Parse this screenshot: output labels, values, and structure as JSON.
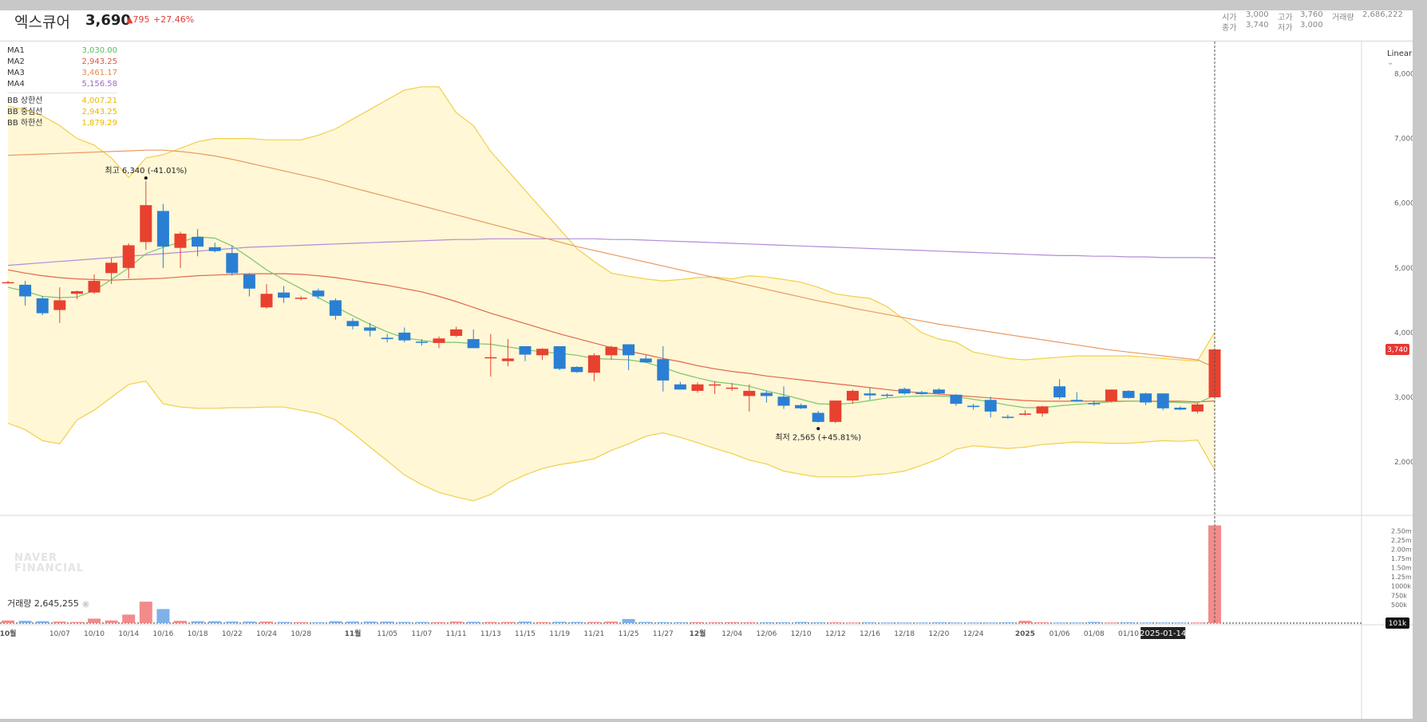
{
  "header": {
    "name": "엑스큐어",
    "price": "3,690",
    "diff": "▲795",
    "rate": "+27.46%",
    "open_label": "시가",
    "open_value": "3,000",
    "high_label": "고가",
    "high_value": "3,760",
    "volume_label": "거래량",
    "volume_value": "2,686,222",
    "close_label": "종가",
    "close_value": "3,740",
    "low_label": "저가",
    "low_value": "3,000"
  },
  "legend": {
    "ma": [
      {
        "name": "MA1",
        "value": "3,030.00",
        "color": "#5cb85c"
      },
      {
        "name": "MA2",
        "value": "2,943.25",
        "color": "#e2543a"
      },
      {
        "name": "MA3",
        "value": "3,461.17",
        "color": "#e68a4f"
      },
      {
        "name": "MA4",
        "value": "5,156.58",
        "color": "#9b6bcc"
      }
    ],
    "bb": [
      {
        "name": "BB 상한선",
        "value": "4,007.21",
        "color": "#e6b800"
      },
      {
        "name": "BB 중심선",
        "value": "2,943.25",
        "color": "#e6b800"
      },
      {
        "name": "BB 하한선",
        "value": "1,879.29",
        "color": "#e6b800"
      }
    ]
  },
  "scale_mode": "Linear",
  "watermark": [
    "NAVER",
    "FINANCIAL"
  ],
  "volume_title": "거래량 2,645,255",
  "colors": {
    "up": "#e8412f",
    "down": "#2a7fd4",
    "up_vol": "#f28b8b",
    "down_vol": "#7fb1e8",
    "band_fill": "#fff7d6"
  },
  "chart_data": {
    "type": "candlestick",
    "price_axis": {
      "ticks": [
        2000,
        3000,
        4000,
        5000,
        6000,
        7000,
        8000
      ],
      "tick_labels": [
        "2,000",
        "3,000",
        "4,000",
        "5,000",
        "6,000",
        "7,000",
        "8,000"
      ],
      "range": [
        1200,
        8500
      ]
    },
    "volume_axis": {
      "ticks": [
        500000,
        750000,
        1000000,
        1250000,
        1500000,
        1750000,
        2000000,
        2250000,
        2500000
      ],
      "tick_labels": [
        "500k",
        "750k",
        "1000k",
        "1.25m",
        "1.50m",
        "1.75m",
        "2.00m",
        "2.25m",
        "2.50m"
      ],
      "max": 2700000,
      "current_label": "101k"
    },
    "x_labels": [
      {
        "i": 0,
        "label": "10월",
        "bold": true
      },
      {
        "i": 3,
        "label": "10/07"
      },
      {
        "i": 5,
        "label": "10/10"
      },
      {
        "i": 7,
        "label": "10/14"
      },
      {
        "i": 9,
        "label": "10/16"
      },
      {
        "i": 11,
        "label": "10/18"
      },
      {
        "i": 13,
        "label": "10/22"
      },
      {
        "i": 15,
        "label": "10/24"
      },
      {
        "i": 17,
        "label": "10/28"
      },
      {
        "i": 20,
        "label": "11월",
        "bold": true
      },
      {
        "i": 22,
        "label": "11/05"
      },
      {
        "i": 24,
        "label": "11/07"
      },
      {
        "i": 26,
        "label": "11/11"
      },
      {
        "i": 28,
        "label": "11/13"
      },
      {
        "i": 30,
        "label": "11/15"
      },
      {
        "i": 32,
        "label": "11/19"
      },
      {
        "i": 34,
        "label": "11/21"
      },
      {
        "i": 36,
        "label": "11/25"
      },
      {
        "i": 38,
        "label": "11/27"
      },
      {
        "i": 40,
        "label": "12월",
        "bold": true
      },
      {
        "i": 42,
        "label": "12/04"
      },
      {
        "i": 44,
        "label": "12/06"
      },
      {
        "i": 46,
        "label": "12/10"
      },
      {
        "i": 48,
        "label": "12/12"
      },
      {
        "i": 50,
        "label": "12/16"
      },
      {
        "i": 52,
        "label": "12/18"
      },
      {
        "i": 54,
        "label": "12/20"
      },
      {
        "i": 56,
        "label": "12/24"
      },
      {
        "i": 59,
        "label": "2025",
        "bold": true
      },
      {
        "i": 61,
        "label": "01/06"
      },
      {
        "i": 63,
        "label": "01/08"
      },
      {
        "i": 65,
        "label": "01/10"
      },
      {
        "i": 67,
        "label": "2025-01-14",
        "current": true
      }
    ],
    "candles": [
      [
        4780,
        4800,
        4760,
        4780
      ],
      [
        4740,
        4800,
        4420,
        4560
      ],
      [
        4530,
        4560,
        4270,
        4300
      ],
      [
        4350,
        4700,
        4150,
        4500
      ],
      [
        4600,
        4650,
        4520,
        4640
      ],
      [
        4620,
        4900,
        4600,
        4800
      ],
      [
        4920,
        5150,
        4750,
        5080
      ],
      [
        5000,
        5380,
        4840,
        5350
      ],
      [
        5400,
        6340,
        5280,
        5970
      ],
      [
        5880,
        5990,
        5000,
        5330
      ],
      [
        5310,
        5560,
        5000,
        5530
      ],
      [
        5480,
        5600,
        5180,
        5330
      ],
      [
        5320,
        5390,
        5240,
        5260
      ],
      [
        5230,
        5350,
        4880,
        4920
      ],
      [
        4900,
        4920,
        4560,
        4680
      ],
      [
        4390,
        4750,
        4370,
        4600
      ],
      [
        4620,
        4720,
        4460,
        4540
      ],
      [
        4530,
        4560,
        4500,
        4540
      ],
      [
        4650,
        4680,
        4520,
        4560
      ],
      [
        4500,
        4530,
        4200,
        4260
      ],
      [
        4180,
        4220,
        4050,
        4100
      ],
      [
        4080,
        4150,
        3940,
        4030
      ],
      [
        3920,
        3980,
        3850,
        3900
      ],
      [
        4000,
        4080,
        3850,
        3880
      ],
      [
        3860,
        3900,
        3800,
        3850
      ],
      [
        3840,
        3940,
        3760,
        3910
      ],
      [
        3950,
        4090,
        3930,
        4050
      ],
      [
        3900,
        4050,
        3760,
        3760
      ],
      [
        3620,
        3980,
        3320,
        3620
      ],
      [
        3560,
        3900,
        3480,
        3600
      ],
      [
        3790,
        3790,
        3560,
        3660
      ],
      [
        3650,
        3760,
        3580,
        3750
      ],
      [
        3790,
        3790,
        3420,
        3440
      ],
      [
        3470,
        3480,
        3380,
        3390
      ],
      [
        3380,
        3680,
        3250,
        3650
      ],
      [
        3650,
        3800,
        3580,
        3780
      ],
      [
        3820,
        3820,
        3420,
        3650
      ],
      [
        3600,
        3650,
        3530,
        3540
      ],
      [
        3590,
        3790,
        3090,
        3260
      ],
      [
        3200,
        3240,
        3120,
        3120
      ],
      [
        3100,
        3230,
        3070,
        3200
      ],
      [
        3200,
        3250,
        3050,
        3200
      ],
      [
        3150,
        3220,
        3100,
        3150
      ],
      [
        3020,
        3200,
        2780,
        3100
      ],
      [
        3070,
        3100,
        2920,
        3020
      ],
      [
        3010,
        3170,
        2820,
        2870
      ],
      [
        2880,
        2900,
        2820,
        2830
      ],
      [
        2760,
        2790,
        2610,
        2620
      ],
      [
        2620,
        2950,
        2600,
        2950
      ],
      [
        2950,
        3120,
        2900,
        3100
      ],
      [
        3060,
        3150,
        2960,
        3030
      ],
      [
        3040,
        3060,
        3000,
        3030
      ],
      [
        3130,
        3150,
        3040,
        3060
      ],
      [
        3080,
        3100,
        3040,
        3050
      ],
      [
        3120,
        3140,
        3050,
        3060
      ],
      [
        3040,
        3050,
        2870,
        2900
      ],
      [
        2870,
        2900,
        2810,
        2850
      ],
      [
        2960,
        3010,
        2690,
        2780
      ],
      [
        2700,
        2730,
        2670,
        2690
      ],
      [
        2730,
        2800,
        2720,
        2750
      ],
      [
        2750,
        2870,
        2700,
        2860
      ],
      [
        3170,
        3280,
        2970,
        3000
      ],
      [
        2960,
        3080,
        2930,
        2940
      ],
      [
        2910,
        2950,
        2870,
        2900
      ],
      [
        2940,
        3120,
        2920,
        3120
      ],
      [
        3100,
        3110,
        2980,
        2990
      ],
      [
        3060,
        3070,
        2880,
        2920
      ],
      [
        3060,
        3060,
        2800,
        2830
      ],
      [
        2840,
        2860,
        2800,
        2810
      ],
      [
        2780,
        2910,
        2750,
        2890
      ],
      [
        3000,
        3760,
        3000,
        3740
      ]
    ],
    "volumes": [
      [
        0,
        70000
      ],
      [
        1,
        60000
      ],
      [
        2,
        50000
      ],
      [
        3,
        40000
      ],
      [
        4,
        30000
      ],
      [
        5,
        120000
      ],
      [
        6,
        70000
      ],
      [
        7,
        230000
      ],
      [
        8,
        580000
      ],
      [
        9,
        380000
      ],
      [
        10,
        60000
      ],
      [
        11,
        50000
      ],
      [
        12,
        50000
      ],
      [
        13,
        40000
      ],
      [
        14,
        40000
      ],
      [
        15,
        40000
      ],
      [
        16,
        30000
      ],
      [
        17,
        25000
      ],
      [
        18,
        20000
      ],
      [
        19,
        50000
      ],
      [
        20,
        40000
      ],
      [
        21,
        40000
      ],
      [
        22,
        40000
      ],
      [
        23,
        30000
      ],
      [
        24,
        30000
      ],
      [
        25,
        25000
      ],
      [
        26,
        40000
      ],
      [
        27,
        35000
      ],
      [
        28,
        30000
      ],
      [
        29,
        30000
      ],
      [
        30,
        40000
      ],
      [
        31,
        25000
      ],
      [
        32,
        35000
      ],
      [
        33,
        30000
      ],
      [
        34,
        30000
      ],
      [
        35,
        40000
      ],
      [
        36,
        110000
      ],
      [
        37,
        30000
      ],
      [
        38,
        25000
      ],
      [
        39,
        20000
      ],
      [
        40,
        25000
      ],
      [
        41,
        20000
      ],
      [
        42,
        25000
      ],
      [
        43,
        20000
      ],
      [
        44,
        20000
      ],
      [
        45,
        20000
      ],
      [
        46,
        30000
      ],
      [
        47,
        20000
      ],
      [
        48,
        20000
      ],
      [
        49,
        15000
      ],
      [
        50,
        20000
      ],
      [
        51,
        15000
      ],
      [
        52,
        15000
      ],
      [
        53,
        15000
      ],
      [
        54,
        20000
      ],
      [
        55,
        15000
      ],
      [
        56,
        15000
      ],
      [
        57,
        15000
      ],
      [
        58,
        20000
      ],
      [
        59,
        60000
      ],
      [
        60,
        20000
      ],
      [
        61,
        15000
      ],
      [
        62,
        15000
      ],
      [
        63,
        30000
      ],
      [
        64,
        15000
      ],
      [
        65,
        20000
      ],
      [
        66,
        15000
      ],
      [
        67,
        15000
      ],
      [
        68,
        15000
      ],
      [
        69,
        15000
      ],
      [
        70,
        2645255
      ]
    ],
    "ma1": [
      4700,
      4640,
      4560,
      4540,
      4550,
      4650,
      4820,
      5000,
      5220,
      5320,
      5400,
      5480,
      5460,
      5340,
      5160,
      4970,
      4820,
      4680,
      4540,
      4400,
      4260,
      4130,
      4010,
      3920,
      3880,
      3850,
      3850,
      3830,
      3820,
      3780,
      3740,
      3700,
      3680,
      3650,
      3600,
      3590,
      3580,
      3540,
      3460,
      3370,
      3300,
      3240,
      3210,
      3170,
      3100,
      3040,
      2970,
      2900,
      2890,
      2910,
      2950,
      2990,
      3010,
      3020,
      3020,
      3010,
      2970,
      2930,
      2880,
      2840,
      2840,
      2870,
      2890,
      2910,
      2930,
      2940,
      2940,
      2930,
      2920,
      2910,
      3030
    ],
    "ma2": [
      4970,
      4920,
      4880,
      4850,
      4830,
      4820,
      4810,
      4820,
      4830,
      4840,
      4860,
      4880,
      4890,
      4900,
      4910,
      4910,
      4910,
      4900,
      4880,
      4850,
      4810,
      4770,
      4730,
      4680,
      4630,
      4560,
      4480,
      4390,
      4300,
      4220,
      4140,
      4060,
      3980,
      3910,
      3840,
      3770,
      3710,
      3660,
      3600,
      3550,
      3490,
      3440,
      3400,
      3370,
      3330,
      3300,
      3270,
      3240,
      3210,
      3180,
      3150,
      3120,
      3090,
      3070,
      3050,
      3030,
      3010,
      2990,
      2970,
      2950,
      2940,
      2940,
      2940,
      2940,
      2940,
      2940,
      2940,
      2940,
      2940,
      2930,
      2943
    ],
    "ma3": [
      6740,
      6750,
      6760,
      6770,
      6780,
      6790,
      6800,
      6810,
      6820,
      6820,
      6800,
      6770,
      6730,
      6680,
      6620,
      6560,
      6500,
      6440,
      6380,
      6310,
      6240,
      6170,
      6100,
      6030,
      5960,
      5890,
      5820,
      5750,
      5680,
      5610,
      5540,
      5470,
      5400,
      5330,
      5270,
      5210,
      5150,
      5090,
      5030,
      4970,
      4910,
      4850,
      4790,
      4730,
      4670,
      4610,
      4550,
      4490,
      4440,
      4380,
      4330,
      4280,
      4230,
      4180,
      4130,
      4090,
      4050,
      4010,
      3970,
      3930,
      3890,
      3850,
      3810,
      3770,
      3730,
      3700,
      3670,
      3640,
      3610,
      3580,
      3461
    ],
    "ma4": [
      5040,
      5060,
      5080,
      5100,
      5120,
      5140,
      5160,
      5180,
      5200,
      5220,
      5240,
      5260,
      5280,
      5300,
      5320,
      5330,
      5340,
      5350,
      5360,
      5370,
      5380,
      5390,
      5400,
      5410,
      5420,
      5430,
      5440,
      5440,
      5450,
      5450,
      5450,
      5450,
      5450,
      5450,
      5450,
      5440,
      5440,
      5430,
      5420,
      5410,
      5400,
      5390,
      5380,
      5370,
      5360,
      5350,
      5340,
      5330,
      5320,
      5310,
      5300,
      5290,
      5280,
      5270,
      5260,
      5250,
      5240,
      5230,
      5220,
      5210,
      5200,
      5190,
      5190,
      5180,
      5180,
      5170,
      5170,
      5160,
      5160,
      5160,
      5157
    ],
    "bb_upper": [
      7500,
      7450,
      7350,
      7200,
      7000,
      6900,
      6700,
      6400,
      6700,
      6750,
      6850,
      6950,
      7000,
      7000,
      7000,
      6980,
      6980,
      6980,
      7050,
      7150,
      7300,
      7450,
      7600,
      7750,
      7800,
      7800,
      7400,
      7200,
      6800,
      6500,
      6200,
      5900,
      5600,
      5300,
      5100,
      4920,
      4870,
      4830,
      4800,
      4820,
      4850,
      4860,
      4830,
      4880,
      4860,
      4820,
      4780,
      4700,
      4600,
      4560,
      4530,
      4400,
      4200,
      4000,
      3900,
      3850,
      3700,
      3650,
      3600,
      3580,
      3600,
      3620,
      3640,
      3640,
      3640,
      3640,
      3620,
      3600,
      3580,
      3560,
      4007
    ],
    "bb_lower": [
      2600,
      2500,
      2330,
      2280,
      2650,
      2800,
      3000,
      3200,
      3250,
      2900,
      2850,
      2830,
      2830,
      2840,
      2840,
      2850,
      2850,
      2800,
      2750,
      2650,
      2450,
      2230,
      2020,
      1800,
      1650,
      1530,
      1460,
      1400,
      1500,
      1680,
      1800,
      1900,
      1960,
      2000,
      2050,
      2180,
      2280,
      2400,
      2450,
      2380,
      2300,
      2210,
      2130,
      2030,
      1970,
      1860,
      1810,
      1770,
      1770,
      1770,
      1800,
      1820,
      1860,
      1950,
      2050,
      2200,
      2250,
      2230,
      2210,
      2230,
      2270,
      2290,
      2310,
      2300,
      2290,
      2290,
      2310,
      2330,
      2320,
      2340,
      1879
    ],
    "annotations": [
      {
        "type": "high",
        "i": 8,
        "value": 6340,
        "label": "최고 6,340 (-41.01%)"
      },
      {
        "type": "low",
        "i": 47,
        "value": 2565,
        "label": "최저 2,565 (+45.81%)"
      }
    ],
    "current_price_label": "3,740"
  }
}
